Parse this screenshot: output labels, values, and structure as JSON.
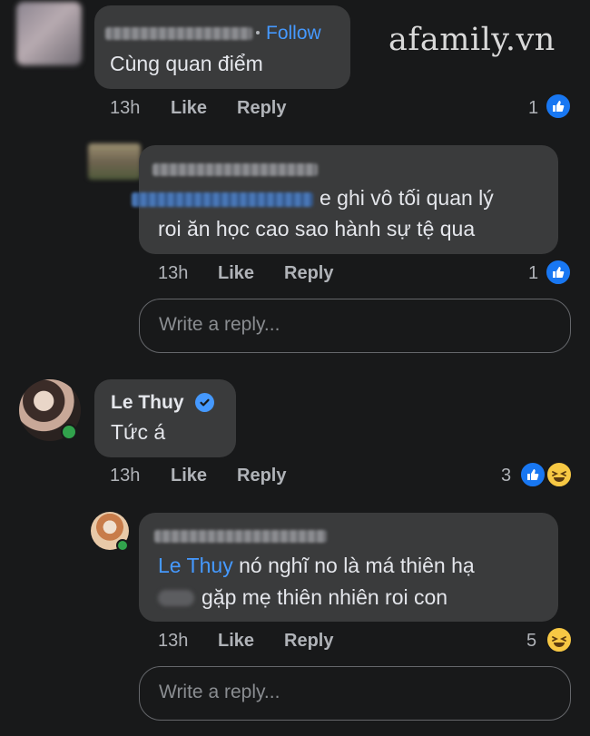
{
  "watermark": "afamily.vn",
  "comments": [
    {
      "follow_label": "Follow",
      "text": "Cùng quan điểm",
      "time": "13h",
      "like_label": "Like",
      "reply_label": "Reply",
      "reaction_count": "1",
      "reactions": [
        "like"
      ]
    },
    {
      "text_line1": "e ghi vô tối quan lý",
      "text_line2": "roi ăn học cao sao hành sự tệ qua",
      "time": "13h",
      "like_label": "Like",
      "reply_label": "Reply",
      "reaction_count": "1",
      "reactions": [
        "like"
      ],
      "reply_placeholder": "Write a reply..."
    },
    {
      "author": "Le Thuy",
      "verified": true,
      "text": "Tức á",
      "time": "13h",
      "like_label": "Like",
      "reply_label": "Reply",
      "reaction_count": "3",
      "reactions": [
        "like",
        "haha"
      ]
    },
    {
      "mention": "Le Thuy",
      "text_line1": " nó nghĩ no là má thiên hạ",
      "text_line2": "gặp mẹ thiên nhiên roi con",
      "time": "13h",
      "like_label": "Like",
      "reply_label": "Reply",
      "reaction_count": "5",
      "reactions": [
        "haha"
      ],
      "reply_placeholder": "Write a reply..."
    }
  ],
  "colors": {
    "background": "#18191a",
    "bubble": "#3a3b3c",
    "link": "#4599ff",
    "like_blue": "#1877f2",
    "haha_yellow": "#f7c844",
    "online_green": "#31a24c"
  }
}
